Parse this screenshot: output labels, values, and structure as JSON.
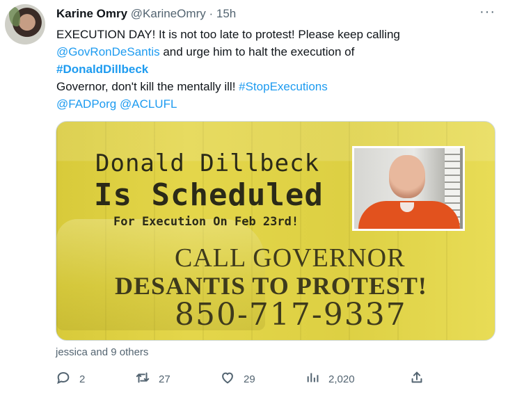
{
  "tweet": {
    "author_name": "Karine Omry",
    "author_handle": "@KarineOmry",
    "separator": "·",
    "timestamp": "15h",
    "more_label": "···",
    "text_lines": [
      [
        {
          "t": "EXECUTION DAY! It is not too late to protest! Please keep calling",
          "k": "plain"
        }
      ],
      [
        {
          "t": "@GovRonDeSantis",
          "k": "link"
        },
        {
          "t": " and urge him to halt the execution of",
          "k": "plain"
        }
      ],
      [
        {
          "t": "#DonaldDillbeck",
          "k": "link-bold"
        }
      ],
      [
        {
          "t": "Governor, don't kill the mentally ill! ",
          "k": "plain"
        },
        {
          "t": "#StopExecutions",
          "k": "link"
        }
      ],
      [
        {
          "t": "@FADPorg",
          "k": "link"
        },
        {
          "t": " ",
          "k": "plain"
        },
        {
          "t": "@ACLUFL",
          "k": "link"
        }
      ]
    ]
  },
  "media": {
    "line1": "Donald Dillbeck",
    "line2": "Is Scheduled",
    "line3": "For Execution On Feb 23rd!",
    "call": "CALL GOVERNOR",
    "desantis": "DESANTIS TO PROTEST!",
    "phone": "850-717-9337"
  },
  "liked_by": "jessica and 9 others",
  "actions": {
    "reply_count": "2",
    "retweet_count": "27",
    "like_count": "29",
    "views_count": "2,020"
  },
  "colors": {
    "link": "#1d9bf0",
    "secondary_text": "#536471",
    "primary_text": "#0f1419",
    "media_yellow": "#ddd043"
  }
}
